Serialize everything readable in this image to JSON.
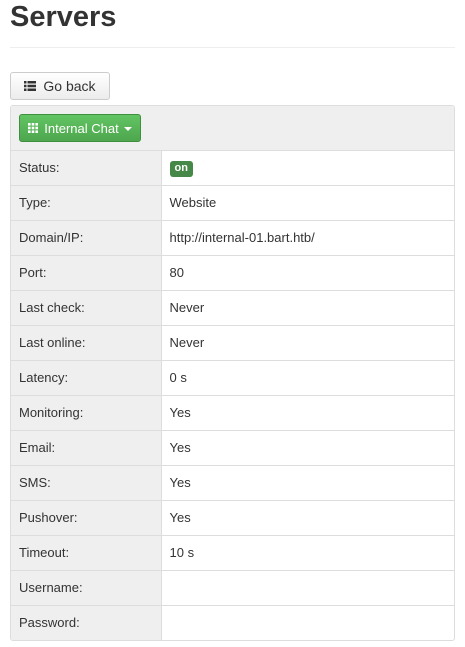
{
  "page": {
    "title": "Servers"
  },
  "toolbar": {
    "back_label": "Go back"
  },
  "server_menu": {
    "label": "Internal Chat"
  },
  "details": [
    {
      "label": "Status:",
      "badge": "on"
    },
    {
      "label": "Type:",
      "value": "Website"
    },
    {
      "label": "Domain/IP:",
      "value": "http://internal-01.bart.htb/"
    },
    {
      "label": "Port:",
      "value": "80"
    },
    {
      "label": "Last check:",
      "value": "Never"
    },
    {
      "label": "Last online:",
      "value": "Never"
    },
    {
      "label": "Latency:",
      "value": "0 s"
    },
    {
      "label": "Monitoring:",
      "value": "Yes"
    },
    {
      "label": "Email:",
      "value": "Yes"
    },
    {
      "label": "SMS:",
      "value": "Yes"
    },
    {
      "label": "Pushover:",
      "value": "Yes"
    },
    {
      "label": "Timeout:",
      "value": "10 s"
    },
    {
      "label": "Username:",
      "value": ""
    },
    {
      "label": "Password:",
      "value": ""
    }
  ],
  "colors": {
    "status_on": "#468847",
    "server_button": "#5bb75b"
  },
  "icons": {
    "back_button": "list-icon",
    "server_button": "grid-icon",
    "dropdown": "caret-down-icon"
  }
}
